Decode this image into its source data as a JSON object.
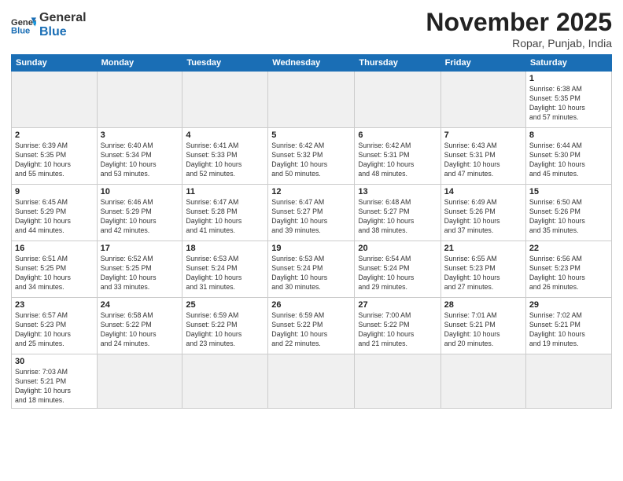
{
  "header": {
    "logo_general": "General",
    "logo_blue": "Blue",
    "month_title": "November 2025",
    "location": "Ropar, Punjab, India"
  },
  "days_of_week": [
    "Sunday",
    "Monday",
    "Tuesday",
    "Wednesday",
    "Thursday",
    "Friday",
    "Saturday"
  ],
  "weeks": [
    [
      {
        "day": "",
        "info": ""
      },
      {
        "day": "",
        "info": ""
      },
      {
        "day": "",
        "info": ""
      },
      {
        "day": "",
        "info": ""
      },
      {
        "day": "",
        "info": ""
      },
      {
        "day": "",
        "info": ""
      },
      {
        "day": "1",
        "info": "Sunrise: 6:38 AM\nSunset: 5:35 PM\nDaylight: 10 hours\nand 57 minutes."
      }
    ],
    [
      {
        "day": "2",
        "info": "Sunrise: 6:39 AM\nSunset: 5:35 PM\nDaylight: 10 hours\nand 55 minutes."
      },
      {
        "day": "3",
        "info": "Sunrise: 6:40 AM\nSunset: 5:34 PM\nDaylight: 10 hours\nand 53 minutes."
      },
      {
        "day": "4",
        "info": "Sunrise: 6:41 AM\nSunset: 5:33 PM\nDaylight: 10 hours\nand 52 minutes."
      },
      {
        "day": "5",
        "info": "Sunrise: 6:42 AM\nSunset: 5:32 PM\nDaylight: 10 hours\nand 50 minutes."
      },
      {
        "day": "6",
        "info": "Sunrise: 6:42 AM\nSunset: 5:31 PM\nDaylight: 10 hours\nand 48 minutes."
      },
      {
        "day": "7",
        "info": "Sunrise: 6:43 AM\nSunset: 5:31 PM\nDaylight: 10 hours\nand 47 minutes."
      },
      {
        "day": "8",
        "info": "Sunrise: 6:44 AM\nSunset: 5:30 PM\nDaylight: 10 hours\nand 45 minutes."
      }
    ],
    [
      {
        "day": "9",
        "info": "Sunrise: 6:45 AM\nSunset: 5:29 PM\nDaylight: 10 hours\nand 44 minutes."
      },
      {
        "day": "10",
        "info": "Sunrise: 6:46 AM\nSunset: 5:29 PM\nDaylight: 10 hours\nand 42 minutes."
      },
      {
        "day": "11",
        "info": "Sunrise: 6:47 AM\nSunset: 5:28 PM\nDaylight: 10 hours\nand 41 minutes."
      },
      {
        "day": "12",
        "info": "Sunrise: 6:47 AM\nSunset: 5:27 PM\nDaylight: 10 hours\nand 39 minutes."
      },
      {
        "day": "13",
        "info": "Sunrise: 6:48 AM\nSunset: 5:27 PM\nDaylight: 10 hours\nand 38 minutes."
      },
      {
        "day": "14",
        "info": "Sunrise: 6:49 AM\nSunset: 5:26 PM\nDaylight: 10 hours\nand 37 minutes."
      },
      {
        "day": "15",
        "info": "Sunrise: 6:50 AM\nSunset: 5:26 PM\nDaylight: 10 hours\nand 35 minutes."
      }
    ],
    [
      {
        "day": "16",
        "info": "Sunrise: 6:51 AM\nSunset: 5:25 PM\nDaylight: 10 hours\nand 34 minutes."
      },
      {
        "day": "17",
        "info": "Sunrise: 6:52 AM\nSunset: 5:25 PM\nDaylight: 10 hours\nand 33 minutes."
      },
      {
        "day": "18",
        "info": "Sunrise: 6:53 AM\nSunset: 5:24 PM\nDaylight: 10 hours\nand 31 minutes."
      },
      {
        "day": "19",
        "info": "Sunrise: 6:53 AM\nSunset: 5:24 PM\nDaylight: 10 hours\nand 30 minutes."
      },
      {
        "day": "20",
        "info": "Sunrise: 6:54 AM\nSunset: 5:24 PM\nDaylight: 10 hours\nand 29 minutes."
      },
      {
        "day": "21",
        "info": "Sunrise: 6:55 AM\nSunset: 5:23 PM\nDaylight: 10 hours\nand 27 minutes."
      },
      {
        "day": "22",
        "info": "Sunrise: 6:56 AM\nSunset: 5:23 PM\nDaylight: 10 hours\nand 26 minutes."
      }
    ],
    [
      {
        "day": "23",
        "info": "Sunrise: 6:57 AM\nSunset: 5:23 PM\nDaylight: 10 hours\nand 25 minutes."
      },
      {
        "day": "24",
        "info": "Sunrise: 6:58 AM\nSunset: 5:22 PM\nDaylight: 10 hours\nand 24 minutes."
      },
      {
        "day": "25",
        "info": "Sunrise: 6:59 AM\nSunset: 5:22 PM\nDaylight: 10 hours\nand 23 minutes."
      },
      {
        "day": "26",
        "info": "Sunrise: 6:59 AM\nSunset: 5:22 PM\nDaylight: 10 hours\nand 22 minutes."
      },
      {
        "day": "27",
        "info": "Sunrise: 7:00 AM\nSunset: 5:22 PM\nDaylight: 10 hours\nand 21 minutes."
      },
      {
        "day": "28",
        "info": "Sunrise: 7:01 AM\nSunset: 5:21 PM\nDaylight: 10 hours\nand 20 minutes."
      },
      {
        "day": "29",
        "info": "Sunrise: 7:02 AM\nSunset: 5:21 PM\nDaylight: 10 hours\nand 19 minutes."
      }
    ],
    [
      {
        "day": "30",
        "info": "Sunrise: 7:03 AM\nSunset: 5:21 PM\nDaylight: 10 hours\nand 18 minutes."
      },
      {
        "day": "",
        "info": ""
      },
      {
        "day": "",
        "info": ""
      },
      {
        "day": "",
        "info": ""
      },
      {
        "day": "",
        "info": ""
      },
      {
        "day": "",
        "info": ""
      },
      {
        "day": "",
        "info": ""
      }
    ]
  ]
}
